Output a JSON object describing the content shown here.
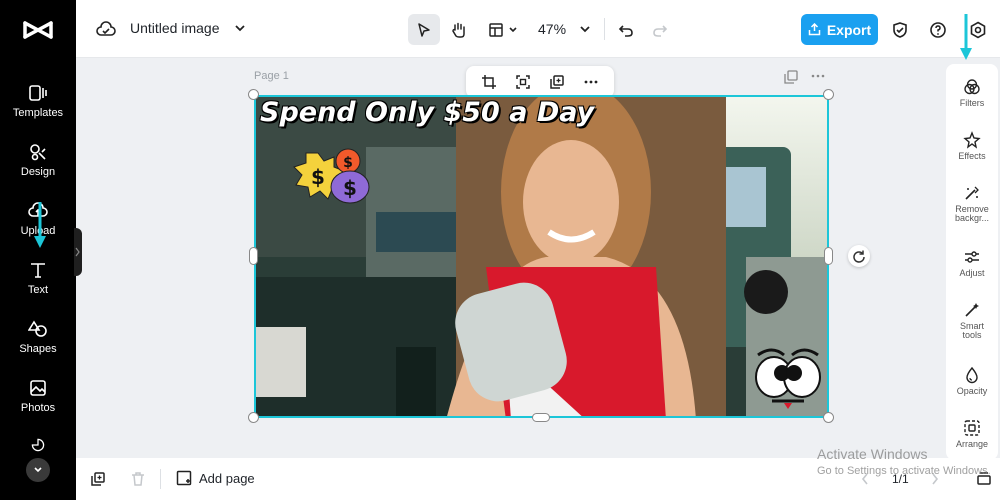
{
  "app": {
    "name": "CapCut"
  },
  "sidebar": {
    "items": [
      {
        "label": "Templates",
        "icon": "templates-icon"
      },
      {
        "label": "Design",
        "icon": "design-icon"
      },
      {
        "label": "Upload",
        "icon": "upload-icon"
      },
      {
        "label": "Text",
        "icon": "text-icon"
      },
      {
        "label": "Shapes",
        "icon": "shapes-icon"
      },
      {
        "label": "Photos",
        "icon": "photos-icon"
      }
    ]
  },
  "header": {
    "title": "Untitled image",
    "zoom": "47%",
    "export_label": "Export"
  },
  "canvas": {
    "page_label": "Page 1",
    "headline": "Spend Only $50 a Day",
    "sticker_text": [
      "$",
      "$",
      "$"
    ]
  },
  "right_panel": {
    "items": [
      {
        "label": "Filters",
        "icon": "filters-icon"
      },
      {
        "label": "Effects",
        "icon": "effects-icon"
      },
      {
        "label": "Remove backgr...",
        "icon": "remove-background-icon"
      },
      {
        "label": "Adjust",
        "icon": "adjust-icon"
      },
      {
        "label": "Smart tools",
        "icon": "smart-tools-icon"
      },
      {
        "label": "Opacity",
        "icon": "opacity-icon"
      },
      {
        "label": "Arrange",
        "icon": "arrange-icon"
      }
    ]
  },
  "footer": {
    "add_page": "Add page",
    "page_count": "1/1"
  },
  "watermark": {
    "line1": "Activate Windows",
    "line2": "Go to Settings to activate Windows."
  },
  "colors": {
    "accent": "#1aa0f0",
    "selection": "#1cc6d8",
    "annotation_arrow": "#1cc6d8"
  }
}
